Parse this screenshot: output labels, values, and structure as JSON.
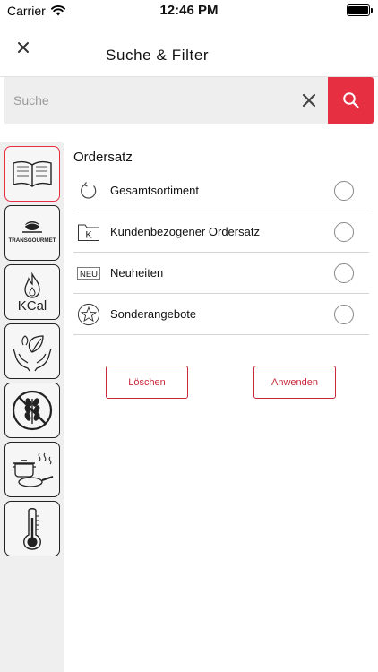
{
  "status_bar": {
    "carrier": "Carrier",
    "time": "12:46 PM"
  },
  "header": {
    "title": "Suche & Filter"
  },
  "search": {
    "placeholder": "Suche",
    "value": ""
  },
  "colors": {
    "accent": "#e63042",
    "sidebar_bg": "#efefef",
    "search_bg": "#eeeeee",
    "divider": "#d4d4d4"
  },
  "sidebar": {
    "items": [
      {
        "icon": "open-book-icon",
        "active": true
      },
      {
        "icon": "transgourmet-logo",
        "logo_text": "TRANSGOURMET",
        "active": false
      },
      {
        "icon": "kcal-flame-icon",
        "text": "KCal",
        "active": false
      },
      {
        "icon": "hands-leaf-icon",
        "active": false
      },
      {
        "icon": "no-grain-icon",
        "active": false
      },
      {
        "icon": "cooking-pots-icon",
        "active": false
      },
      {
        "icon": "thermometer-icon",
        "active": false
      }
    ]
  },
  "main": {
    "section_title": "Ordersatz",
    "options": [
      {
        "label": "Gesamtsortiment",
        "icon": "refresh-icon",
        "selected": false
      },
      {
        "label": "Kundenbezogener Ordersatz",
        "icon": "folder-k-icon",
        "icon_text": "K",
        "selected": false
      },
      {
        "label": "Neuheiten",
        "icon": "new-badge-icon",
        "icon_text": "NEU",
        "selected": false
      },
      {
        "label": "Sonderangebote",
        "icon": "star-circle-icon",
        "selected": false
      }
    ],
    "buttons": {
      "clear_label": "Löschen",
      "apply_label": "Anwenden"
    }
  }
}
